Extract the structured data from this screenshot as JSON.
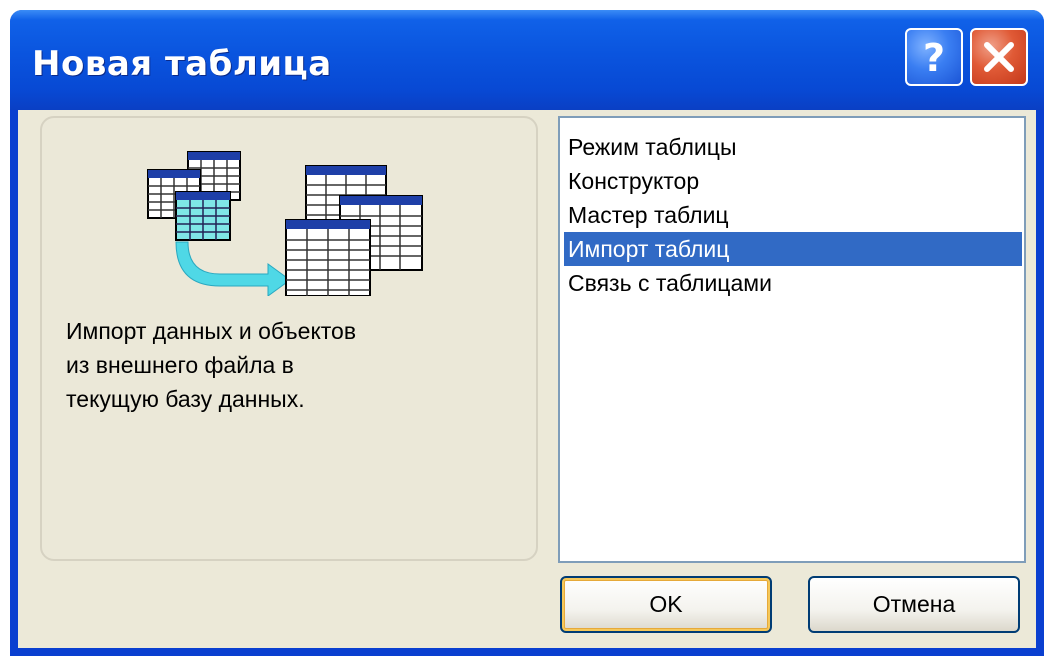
{
  "window": {
    "title": "Новая таблица",
    "help_label": "?",
    "close_label": "×"
  },
  "description": {
    "text": "Импорт данных и объектов\nиз внешнего файла в\nтекущую базу данных.",
    "illustration": "import-tables-icon"
  },
  "list": {
    "items": [
      {
        "label": "Режим таблицы",
        "selected": false
      },
      {
        "label": "Конструктор",
        "selected": false
      },
      {
        "label": "Мастер таблиц",
        "selected": false
      },
      {
        "label": "Импорт таблиц",
        "selected": true
      },
      {
        "label": "Связь с таблицами",
        "selected": false
      }
    ]
  },
  "buttons": {
    "ok_label": "OK",
    "cancel_label": "Отмена"
  },
  "colors": {
    "title_bar": "#0a54de",
    "selection": "#316ac5",
    "dialog_bg": "#ece9d8"
  }
}
